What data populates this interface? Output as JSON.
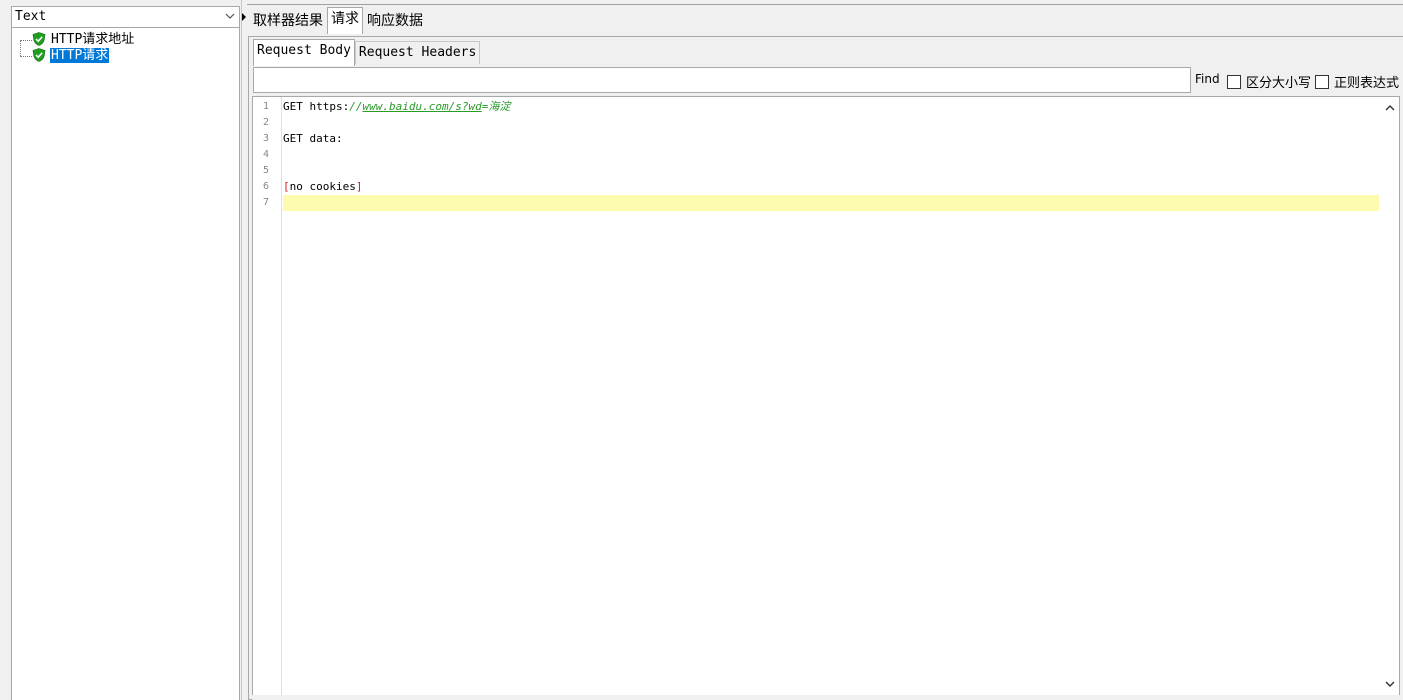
{
  "left_panel": {
    "renderer_select_value": "Text",
    "tree": [
      {
        "label": "HTTP请求地址",
        "status": "success",
        "selected": false
      },
      {
        "label": "HTTP请求",
        "status": "success",
        "selected": true
      }
    ]
  },
  "main_tabs": [
    {
      "label": "取样器结果",
      "active": false
    },
    {
      "label": "请求",
      "active": true
    },
    {
      "label": "响应数据",
      "active": false
    }
  ],
  "sub_tabs": [
    {
      "label": "Request Body",
      "active": true
    },
    {
      "label": "Request Headers",
      "active": false
    }
  ],
  "find_bar": {
    "input_value": "",
    "find_label": "Find",
    "case_sensitive_label": "区分大小写",
    "case_sensitive_checked": false,
    "regex_label": "正则表达式",
    "regex_checked": false
  },
  "editor": {
    "line_numbers": [
      "1",
      "2",
      "3",
      "4",
      "5",
      "6",
      "7"
    ],
    "line1_prefix": "GET https:",
    "line1_slashes": "//",
    "line1_url": "www.baidu.com/s?wd",
    "line1_suffix": "=海淀",
    "line3": "GET data:",
    "line6_open": "[",
    "line6_text": "no cookies",
    "line6_close": "]",
    "current_line": 7
  },
  "colors": {
    "selection_bg": "#0078d7",
    "current_line_bg": "#fdfcae",
    "url_color": "#2a9a2a",
    "bracket_color": "#d02020",
    "success_icon": "#1e9e1e"
  }
}
